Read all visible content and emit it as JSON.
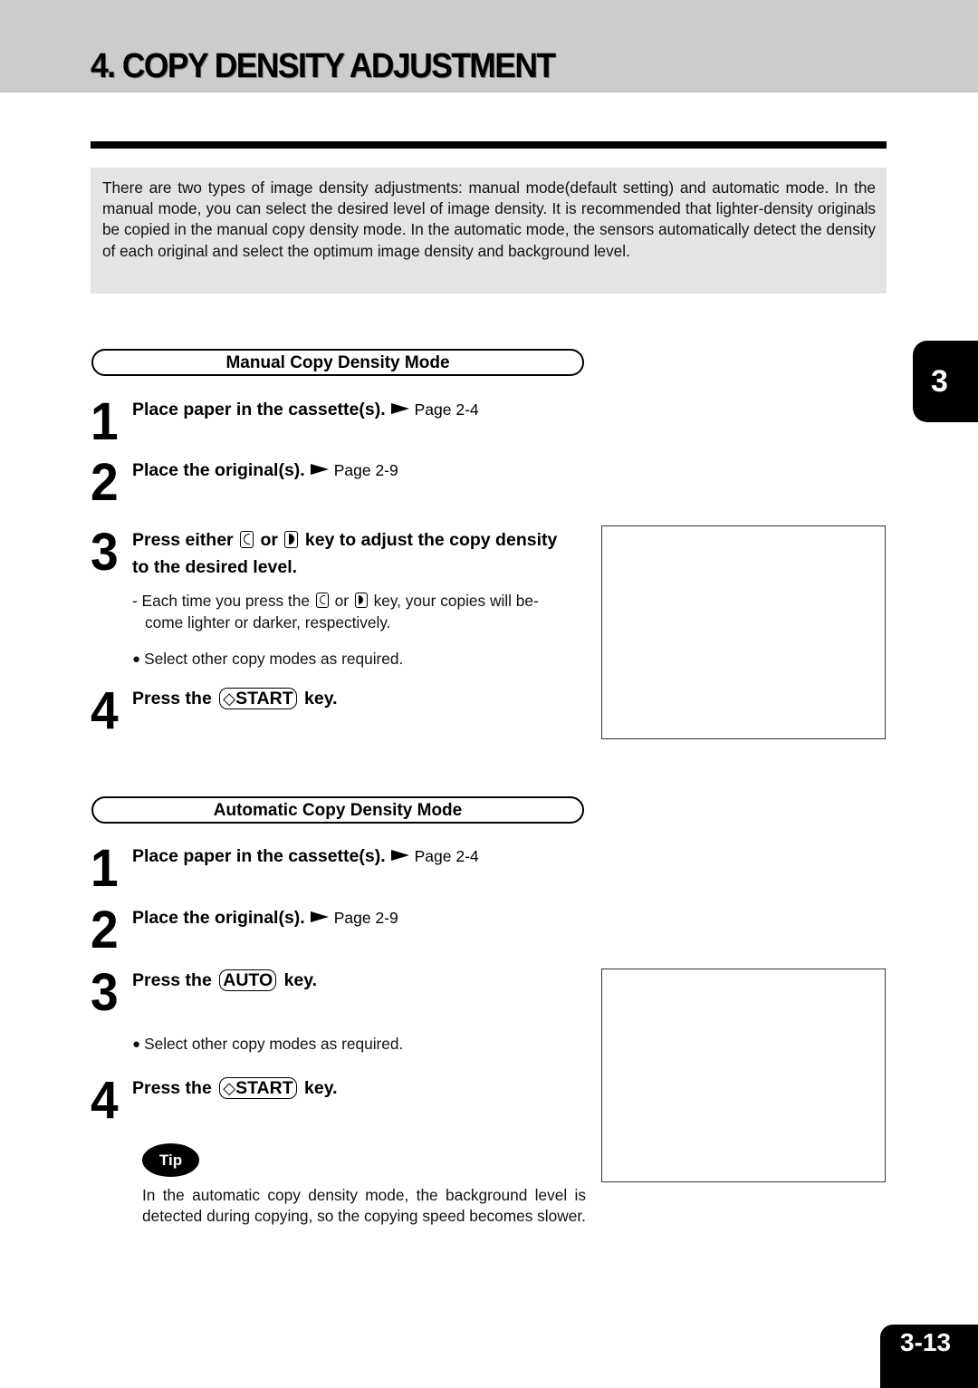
{
  "header": {
    "title": "4. COPY DENSITY ADJUSTMENT"
  },
  "intro": {
    "text": "There are two types of image density adjustments: manual mode(default setting) and automatic mode. In the manual mode, you can select the desired level of image density. It is recommended that lighter-density originals be copied in the manual copy density mode.  In the automatic mode, the sensors automatically detect the density of each original and select the optimum image density and background level."
  },
  "manual": {
    "banner": "Manual Copy Density Mode",
    "steps": [
      {
        "number": "1",
        "text": "Place paper in the cassette(s).",
        "page_ref": "Page 2-4"
      },
      {
        "number": "2",
        "text": "Place the original(s).",
        "page_ref": "Page 2-9"
      },
      {
        "number": "3",
        "text_before": "Press either",
        "text_mid": "or",
        "text_after": "key to adjust the copy density",
        "text_line2": "to the desired level."
      },
      {
        "number": "4",
        "text_before": "Press the",
        "key_label": "START",
        "text_after": "key."
      }
    ],
    "note_prefix": "- Each time you press the",
    "note_mid": "or",
    "note_after": "key, your copies will be-",
    "note_line2": "come lighter or darker, respectively.",
    "bullet": "Select other copy modes as required."
  },
  "automatic": {
    "banner": "Automatic Copy Density Mode",
    "steps": [
      {
        "number": "1",
        "text": "Place paper in the cassette(s).",
        "page_ref": "Page 2-4"
      },
      {
        "number": "2",
        "text": "Place the original(s).",
        "page_ref": "Page 2-9"
      },
      {
        "number": "3",
        "text_before": "Press the",
        "key_label": "AUTO",
        "text_after": "key."
      },
      {
        "number": "4",
        "text_before": "Press the",
        "key_label": "START",
        "text_after": "key."
      }
    ],
    "bullet": "Select other copy modes as required."
  },
  "tip": {
    "badge": "Tip",
    "text": "In the automatic copy density mode, the background level is detected during copying, so the copying speed becomes slower."
  },
  "icons": {
    "diamond": "◇",
    "bullet": "●"
  },
  "chapter_tab": "3",
  "page_number": "3-13"
}
